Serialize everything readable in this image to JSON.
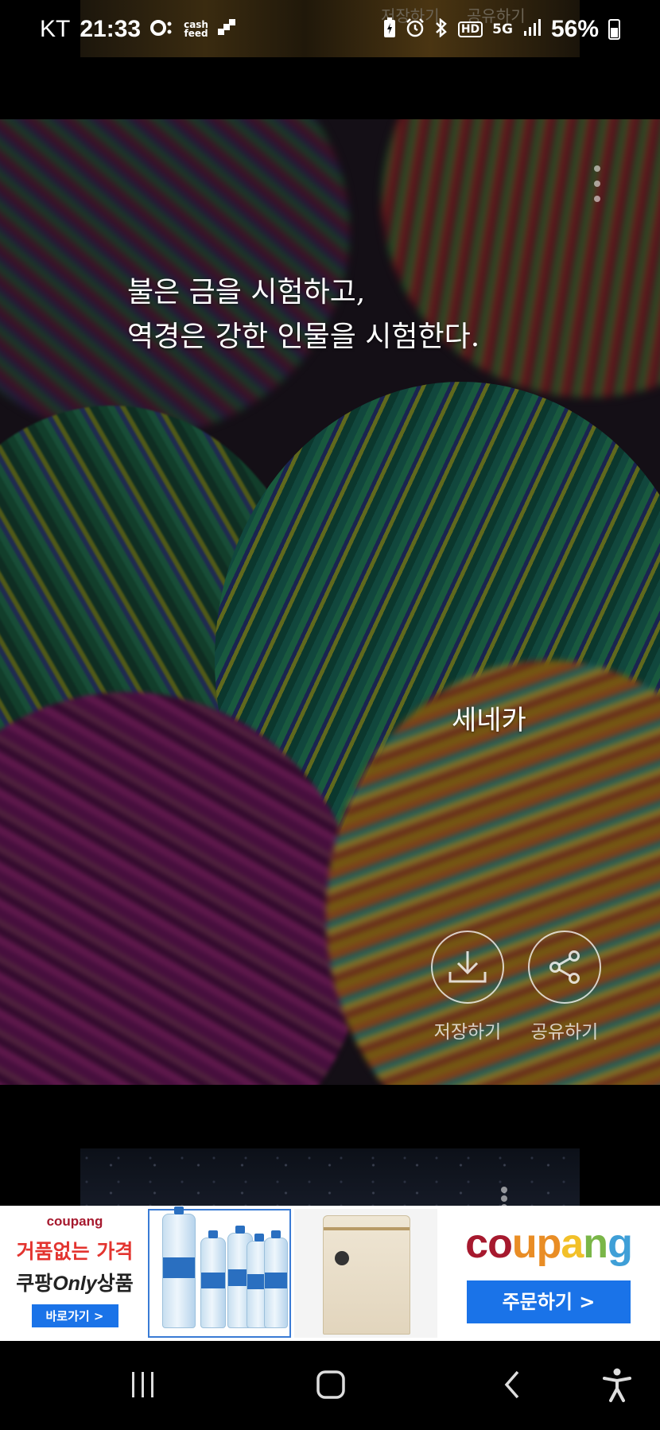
{
  "status_bar": {
    "carrier": "KT",
    "time": "21:33",
    "cashfeed": "cash\nfeed",
    "network": "5G",
    "hd": "HD",
    "battery": "56%"
  },
  "previous_card": {
    "save_label": "저장하기",
    "share_label": "공유하기"
  },
  "quote_card": {
    "quote": "불은 금을 시험하고,\n 역경은 강한 인물을 시험한다.",
    "author": "세네카",
    "save_label": "저장하기",
    "share_label": "공유하기"
  },
  "ad": {
    "mini_logo": "coupang",
    "headline": "거품없는 가격",
    "subline_prefix": "쿠팡",
    "subline_only": "Only",
    "subline_suffix": "상품",
    "go_label": "바로가기 >",
    "brand": "coupang",
    "order_label": "주문하기 >",
    "brand_colors": [
      "#a6192e",
      "#e98d25",
      "#f2c029",
      "#7ab648",
      "#3f9fd7"
    ]
  },
  "nav": {
    "recents": "|||",
    "home": "home",
    "back": "back",
    "accessibility": "accessibility"
  }
}
